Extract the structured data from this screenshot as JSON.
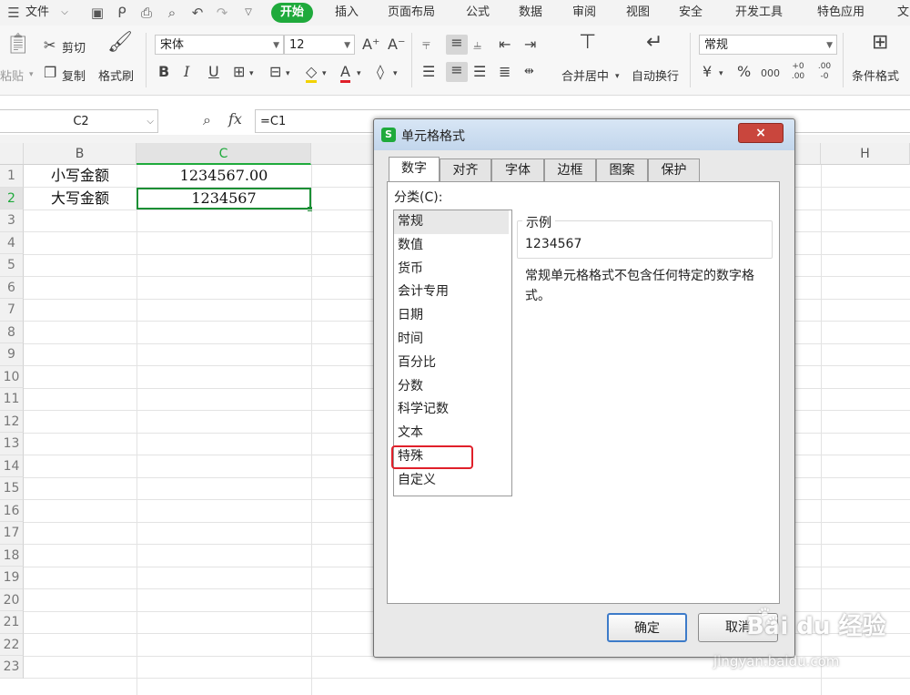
{
  "menu": {
    "file": "文件",
    "tabs": [
      "开始",
      "插入",
      "页面布局",
      "公式",
      "数据",
      "审阅",
      "视图",
      "安全",
      "开发工具",
      "特色应用",
      "文"
    ],
    "active_tab": "开始"
  },
  "toolbar": {
    "paste": "粘贴",
    "cut": "剪切",
    "copy": "复制",
    "format_painter": "格式刷",
    "font_name": "宋体",
    "font_size": "12",
    "bold": "B",
    "italic": "I",
    "underline": "U",
    "font_color_letter": "A",
    "merge_center": "合并居中",
    "wrap_text": "自动换行",
    "number_format": "常规",
    "percent": "%",
    "thousands": "000",
    "inc_decimal": "+0 .00",
    "dec_decimal": ".00 -0",
    "conditional_format": "条件格式"
  },
  "formula_bar": {
    "cell_ref": "C2",
    "fx": "fx",
    "formula": "=C1"
  },
  "sheet": {
    "columns": [
      "B",
      "C",
      "H"
    ],
    "rows": [
      "1",
      "2",
      "3",
      "4",
      "5",
      "6",
      "7",
      "8",
      "9",
      "10",
      "11",
      "12",
      "13",
      "14",
      "15",
      "16",
      "17",
      "18",
      "19",
      "20",
      "21",
      "22",
      "23"
    ],
    "cells": {
      "B1": "小写金额",
      "C1": "1234567.00",
      "B2": "大写金额",
      "C2": "1234567"
    }
  },
  "dialog": {
    "title": "单元格格式",
    "close": "×",
    "tabs": [
      "数字",
      "对齐",
      "字体",
      "边框",
      "图案",
      "保护"
    ],
    "category_label": "分类(C):",
    "categories": [
      "常规",
      "数值",
      "货币",
      "会计专用",
      "日期",
      "时间",
      "百分比",
      "分数",
      "科学记数",
      "文本",
      "特殊",
      "自定义"
    ],
    "selected_category": "常规",
    "highlighted_category": "特殊",
    "sample_label": "示例",
    "sample_value": "1234567",
    "description": "常规单元格格式不包含任何特定的数字格式。",
    "ok": "确定",
    "cancel": "取消"
  },
  "watermark": {
    "brand": "Bai du 经验",
    "url": "jingyan.baidu.com"
  },
  "colors": {
    "accent_green": "#1faa3c",
    "highlight_red": "#e0202a",
    "dialog_title_bg": "#c9dcef",
    "close_button": "#c9463d"
  }
}
